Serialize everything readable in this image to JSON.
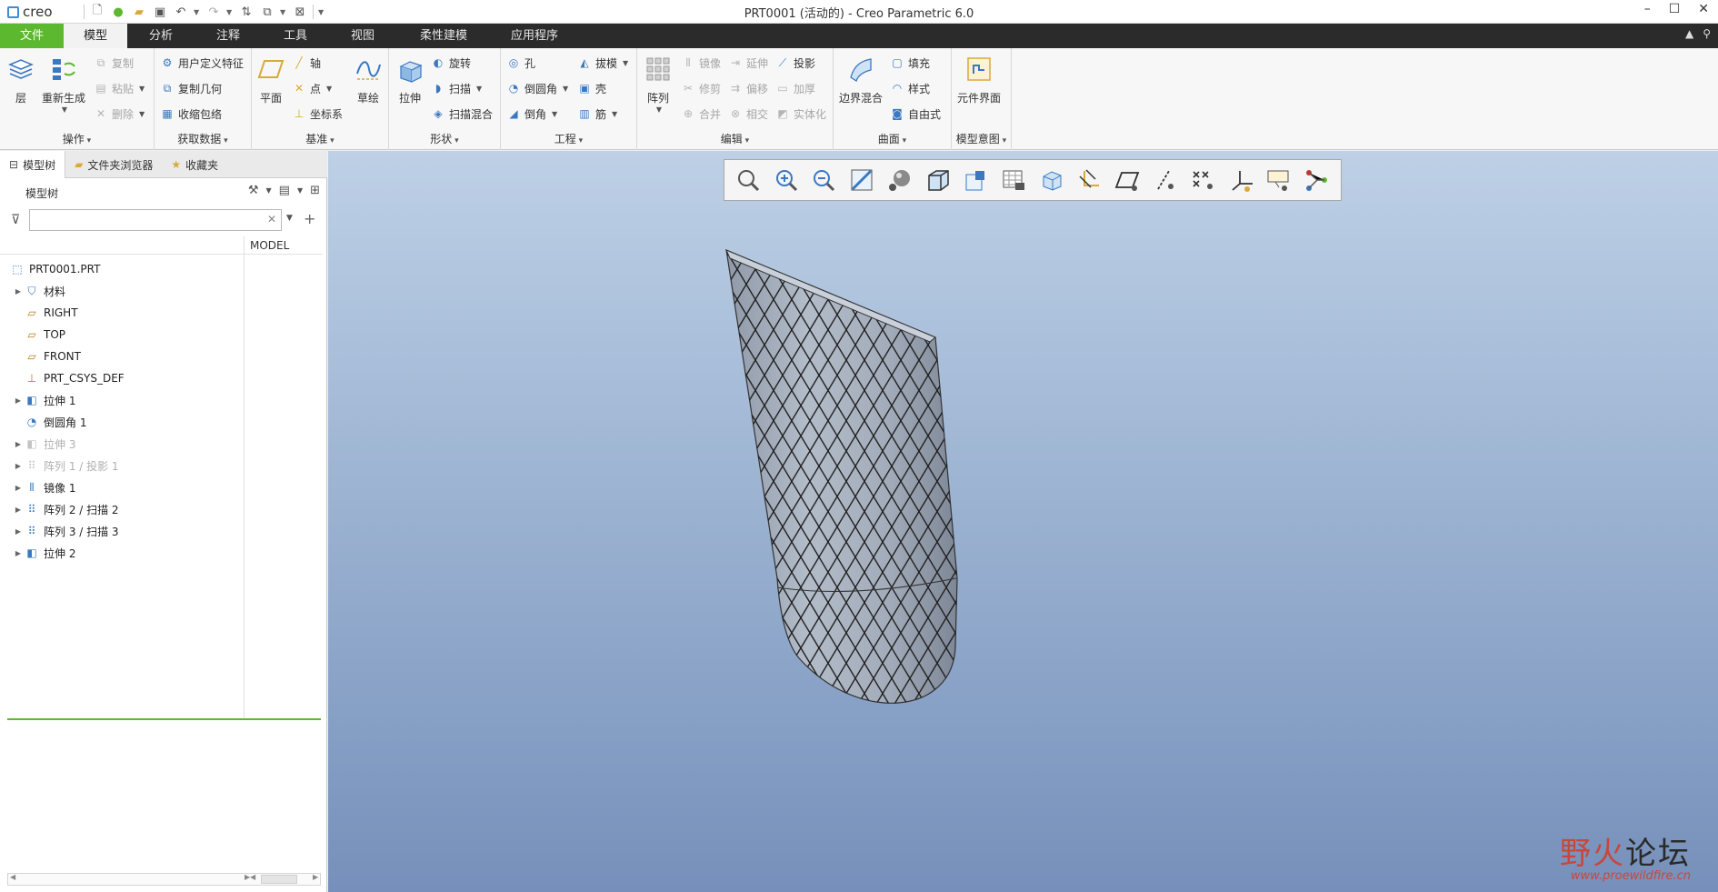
{
  "app": {
    "logo_text": "creo",
    "window_title": "PRT0001 (活动的) - Creo Parametric 6.0"
  },
  "ribbon_tabs": [
    "文件",
    "模型",
    "分析",
    "注释",
    "工具",
    "视图",
    "柔性建模",
    "应用程序"
  ],
  "ribbon": {
    "operations": {
      "label": "操作",
      "layer": "层",
      "regenerate": "重新生成",
      "copy": "复制",
      "paste": "粘贴",
      "delete": "删除"
    },
    "get_data": {
      "label": "获取数据",
      "udf": "用户定义特征",
      "copy_geom": "复制几何",
      "shrinkwrap": "收缩包络"
    },
    "datum": {
      "label": "基准",
      "plane": "平面",
      "axis": "轴",
      "point": "点",
      "csys": "坐标系",
      "sketch": "草绘"
    },
    "shapes": {
      "label": "形状",
      "extrude": "拉伸",
      "revolve": "旋转",
      "sweep": "扫描",
      "swept_blend": "扫描混合"
    },
    "engineering": {
      "label": "工程",
      "hole": "孔",
      "round": "倒圆角",
      "chamfer": "倒角",
      "draft": "拔模",
      "shell": "壳",
      "rib": "筋"
    },
    "editing": {
      "label": "编辑",
      "pattern": "阵列",
      "mirror": "镜像",
      "extend": "延伸",
      "project": "投影",
      "trim": "修剪",
      "offset": "偏移",
      "thicken": "加厚",
      "merge": "合并",
      "intersect": "相交",
      "solidify": "实体化"
    },
    "surfaces": {
      "label": "曲面",
      "boundary_blend": "边界混合",
      "fill": "填充",
      "style": "样式",
      "freestyle": "自由式"
    },
    "model_intent": {
      "label": "模型意图",
      "component_interface": "元件界面"
    }
  },
  "panel": {
    "tabs": [
      "模型树",
      "文件夹浏览器",
      "收藏夹"
    ],
    "tree_title": "模型树",
    "search_placeholder": "",
    "column_header": "MODEL",
    "items": [
      {
        "label": "PRT0001.PRT",
        "icon": "part-icon",
        "expand": false,
        "dim": false,
        "root": true
      },
      {
        "label": "材料",
        "icon": "material-icon",
        "expand": true,
        "dim": false
      },
      {
        "label": "RIGHT",
        "icon": "datum-plane-icon",
        "expand": false,
        "dim": false
      },
      {
        "label": "TOP",
        "icon": "datum-plane-icon",
        "expand": false,
        "dim": false
      },
      {
        "label": "FRONT",
        "icon": "datum-plane-icon",
        "expand": false,
        "dim": false
      },
      {
        "label": "PRT_CSYS_DEF",
        "icon": "csys-icon",
        "expand": false,
        "dim": false
      },
      {
        "label": "拉伸 1",
        "icon": "extrude-icon",
        "expand": true,
        "dim": false
      },
      {
        "label": "倒圆角 1",
        "icon": "round-icon",
        "expand": false,
        "dim": false
      },
      {
        "label": "拉伸 3",
        "icon": "extrude-icon",
        "expand": true,
        "dim": true
      },
      {
        "label": "阵列 1 / 投影 1",
        "icon": "pattern-icon",
        "expand": true,
        "dim": true
      },
      {
        "label": "镜像 1",
        "icon": "mirror-icon",
        "expand": true,
        "dim": false
      },
      {
        "label": "阵列 2 / 扫描 2",
        "icon": "pattern-icon",
        "expand": true,
        "dim": false
      },
      {
        "label": "阵列 3 / 扫描 3",
        "icon": "pattern-icon",
        "expand": true,
        "dim": false
      },
      {
        "label": "拉伸 2",
        "icon": "extrude-icon",
        "expand": true,
        "dim": false
      }
    ]
  },
  "watermark": {
    "main_a": "野火",
    "main_b": "论坛",
    "sub": "www.proewildfire.cn"
  },
  "colors": {
    "file_tab": "#5cb82e",
    "tab_bar": "#2b2b2b",
    "accent_blue": "#3a78c2",
    "insert_line": "#5cb82e"
  }
}
